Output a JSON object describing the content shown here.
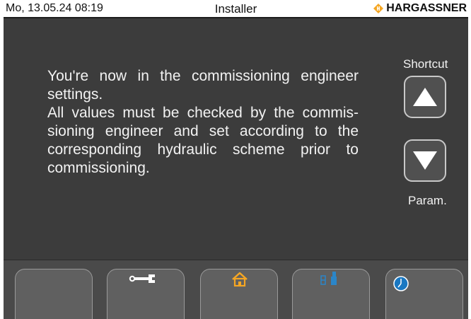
{
  "status_bar": {
    "datetime": "Mo, 13.05.24 08:19",
    "title": "Installer",
    "brand": "HARGASSNER"
  },
  "message": {
    "line1": "You're now in the commissioning engineer settings.",
    "line2": "All values must be checked by the commis-sioning engineer and set according to the corresponding hydraulic scheme prior to commissioning."
  },
  "side_nav": {
    "shortcut_label": "Shortcut",
    "param_label": "Param."
  },
  "bottom_tabs": [
    {
      "icon": "blank"
    },
    {
      "icon": "wrench-icon"
    },
    {
      "icon": "home-icon"
    },
    {
      "icon": "heating-system-icon"
    },
    {
      "icon": "clock-icon"
    }
  ],
  "colors": {
    "background": "#3c3c3c",
    "home_accent": "#f5a623",
    "heating_accent": "#2b86c9",
    "clock_accent": "#1a78c2"
  }
}
